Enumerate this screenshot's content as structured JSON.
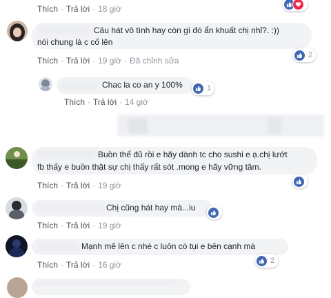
{
  "comments": [
    {
      "id": "c0",
      "text_lines": [],
      "actions": {
        "like": "Thích",
        "reply": "Trả lời",
        "time": "18 giờ",
        "edited": ""
      },
      "reactions": {
        "icons": [
          "like-icon",
          "love-icon"
        ],
        "count": ""
      }
    },
    {
      "id": "c1",
      "text_lines": [
        "Câu hát vô tình hay còn gì đó ẩn khuất chị nhỉ?. :))",
        "nói chung là c cố lên"
      ],
      "actions": {
        "like": "Thích",
        "reply": "Trả lời",
        "time": "19 giờ",
        "edited": "Đã chỉnh sửa"
      },
      "reactions": {
        "icons": [
          "like-icon"
        ],
        "count": "2"
      }
    },
    {
      "id": "r1",
      "text_lines": [
        "Chac la co an y 100%"
      ],
      "actions": {
        "like": "Thích",
        "reply": "Trả lời",
        "time": "14 giờ",
        "edited": ""
      },
      "reactions": {
        "icons": [
          "like-icon"
        ],
        "count": "1"
      }
    },
    {
      "id": "c2",
      "text_lines": [
        "Buồn thế đủ rồi e hãy dành tc cho sushi e ạ.chị lướt",
        "fb thấy e buồn thật sự chị thấy rất sót .mong e hãy vững tâm."
      ],
      "actions": {
        "like": "Thích",
        "reply": "Trả lời",
        "time": "19 giờ",
        "edited": ""
      },
      "reactions": {
        "icons": [
          "like-icon"
        ],
        "count": ""
      }
    },
    {
      "id": "c3",
      "text_lines": [
        "Chị cũng hát hay mà...iu"
      ],
      "actions": {
        "like": "Thích",
        "reply": "Trả lời",
        "time": "19 giờ",
        "edited": ""
      },
      "reactions": {
        "icons": [
          "like-icon"
        ],
        "count": ""
      }
    },
    {
      "id": "c4",
      "text_lines": [
        "Mạnh mẽ lên c nhé c luôn có tụi e bên cạnh mà"
      ],
      "actions": {
        "like": "Thích",
        "reply": "Trả lời",
        "time": "16 giờ",
        "edited": ""
      },
      "reactions": {
        "icons": [
          "like-icon"
        ],
        "count": "2"
      }
    }
  ],
  "colors": {
    "bubble": "#f2f3f5",
    "like_blue": "#4267b2",
    "love_red": "#f0284a",
    "meta_gray": "#90949c"
  }
}
